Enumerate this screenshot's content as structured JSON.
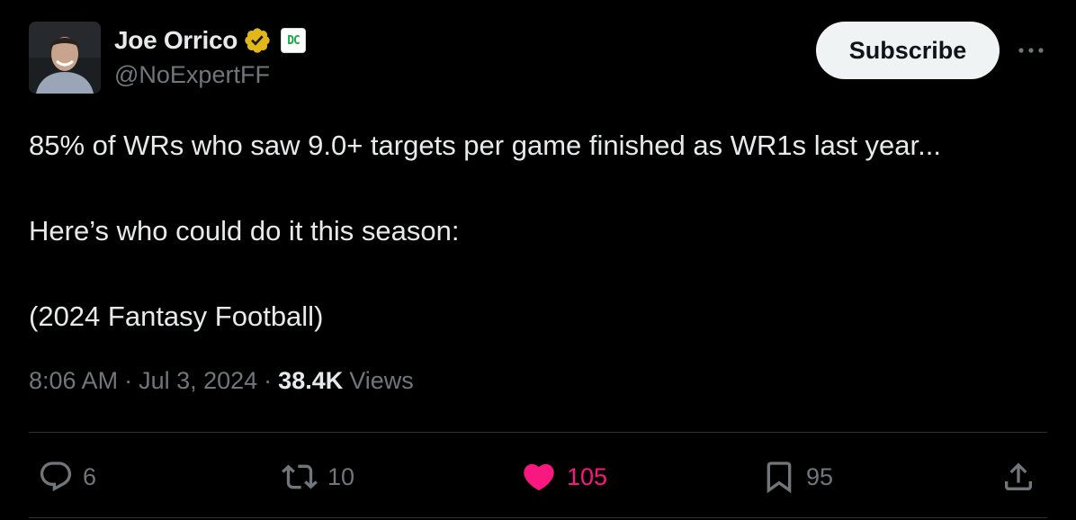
{
  "author": {
    "display_name": "Joe Orrico",
    "handle": "@NoExpertFF",
    "verified_icon": "verified-badge-gold",
    "affiliate_badge": "DC",
    "avatar_icon": "profile-photo"
  },
  "header": {
    "subscribe_label": "Subscribe",
    "more_icon": "more-horizontal"
  },
  "tweet": {
    "lines": [
      "85% of WRs who saw 9.0+ targets per game finished as WR1s last year...",
      "Here’s who could do it this season:",
      "(2024 Fantasy Football)"
    ]
  },
  "meta": {
    "time": "8:06 AM",
    "separator": "·",
    "date": "Jul 3, 2024",
    "views_count": "38.4K",
    "views_label": "Views"
  },
  "actions": {
    "replies": "6",
    "reposts": "10",
    "likes": "105",
    "bookmarks": "95",
    "like_color": "#f91880"
  }
}
